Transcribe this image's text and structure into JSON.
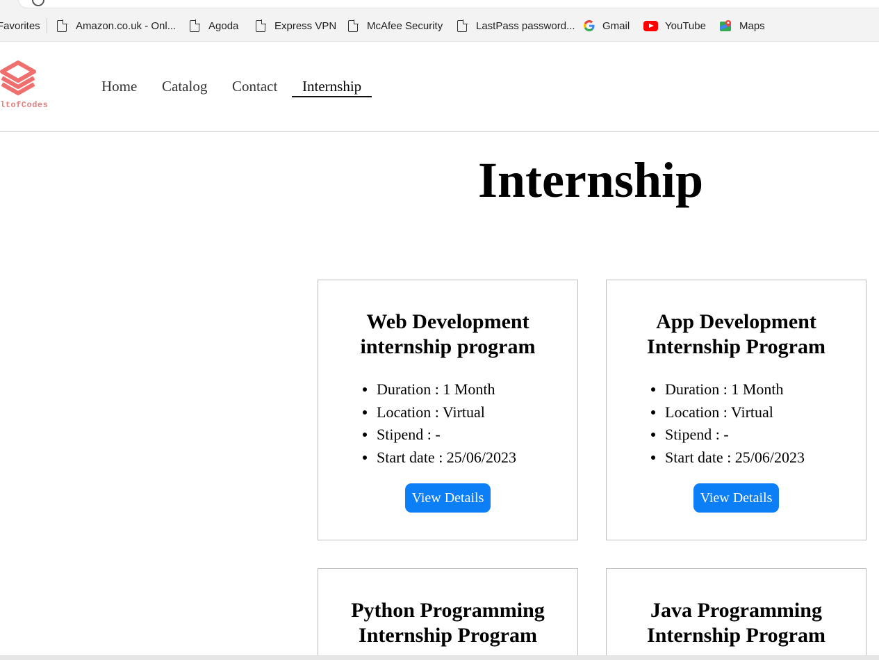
{
  "bookmarks": {
    "favorites_label": "Favorites",
    "items": [
      {
        "label": "Amazon.co.uk - Onl...",
        "icon": "page-icon"
      },
      {
        "label": "Agoda",
        "icon": "page-icon"
      },
      {
        "label": "Express VPN",
        "icon": "page-icon"
      },
      {
        "label": "McAfee Security",
        "icon": "page-icon"
      },
      {
        "label": "LastPass password...",
        "icon": "page-icon"
      },
      {
        "label": "Gmail",
        "icon": "google-icon"
      },
      {
        "label": "YouTube",
        "icon": "youtube-icon"
      },
      {
        "label": "Maps",
        "icon": "maps-icon"
      }
    ]
  },
  "site": {
    "logo_text": "ltofCodes",
    "logo_color": "#e77f7f",
    "nav": [
      {
        "label": "Home"
      },
      {
        "label": "Catalog"
      },
      {
        "label": "Contact"
      },
      {
        "label": "Internship",
        "active": true
      }
    ]
  },
  "main": {
    "title": "Internship",
    "accent_color": "#0d7ff6",
    "cards": [
      {
        "title_line1": "Web Development",
        "title_line2": "internship program",
        "details": [
          "Duration : 1 Month",
          "Location : Virtual",
          "Stipend : -",
          "Start date : 25/06/2023"
        ],
        "button": "View Details"
      },
      {
        "title_line1": "App Development",
        "title_line2": "Internship Program",
        "details": [
          "Duration : 1 Month",
          "Location : Virtual",
          "Stipend : -",
          "Start date : 25/06/2023"
        ],
        "button": "View Details"
      },
      {
        "title_line1": "Python Programming",
        "title_line2": "Internship Program"
      },
      {
        "title_line1": "Java Programming",
        "title_line2": "Internship Program"
      }
    ]
  }
}
